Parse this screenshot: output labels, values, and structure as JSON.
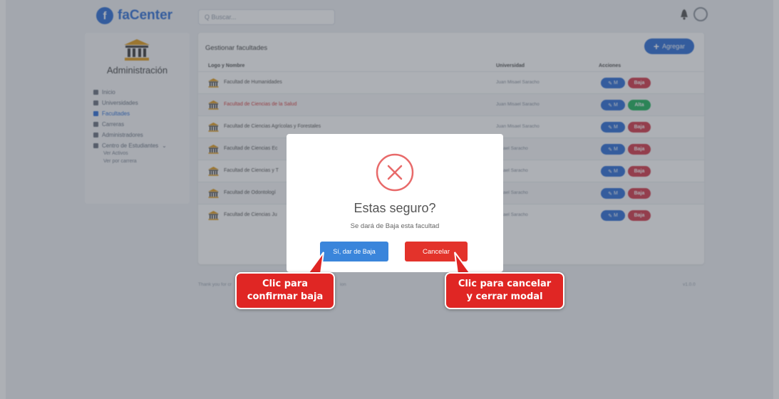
{
  "header": {
    "logo_mark": "f",
    "logo_text": "faCenter",
    "search_placeholder": "Q Buscar..."
  },
  "sidebar": {
    "title": "Administración",
    "items": [
      {
        "label": "Inicio",
        "icon": "home-icon"
      },
      {
        "label": "Universidades",
        "icon": "institution-icon"
      },
      {
        "label": "Facultades",
        "icon": "building-icon",
        "active": true
      },
      {
        "label": "Carreras",
        "icon": "book-icon"
      },
      {
        "label": "Administradores",
        "icon": "users-icon"
      },
      {
        "label": "Centro de Estudiantes",
        "icon": "gear-icon",
        "expandable": true
      }
    ],
    "subitems": [
      "Ver Activos",
      "Ver por carrera"
    ]
  },
  "card": {
    "title": "Gestionar facultades",
    "add_label": "Agregar",
    "columns": [
      "Logo y Nombre",
      "Universidad",
      "Acciones"
    ],
    "edit_label": "M",
    "rows": [
      {
        "name": "Facultad de Humanidades",
        "university": "Juan Misael Saracho",
        "state": "Baja",
        "state_color": "#d33b4c"
      },
      {
        "name": "Facultad de Ciencias de la Salud",
        "university": "Juan Misael Saracho",
        "state": "Alta",
        "state_color": "#22b35e",
        "highlight": true
      },
      {
        "name": "Facultad de Ciencias Agrícolas y Forestales",
        "university": "Juan Misael Saracho",
        "state": "Baja",
        "state_color": "#d33b4c"
      },
      {
        "name": "Facultad de Ciencias Ec",
        "university": "Misael Saracho",
        "state": "Baja",
        "state_color": "#d33b4c"
      },
      {
        "name": "Facultad de Ciencias y T",
        "university": "Misael Saracho",
        "state": "Baja",
        "state_color": "#d33b4c"
      },
      {
        "name": "Facultad de Odontologí",
        "university": "Misael Saracho",
        "state": "Baja",
        "state_color": "#d33b4c"
      },
      {
        "name": "Facultad de Ciencias Ju",
        "university": "Misael Saracho",
        "state": "Baja",
        "state_color": "#d33b4c"
      }
    ]
  },
  "footer": {
    "left": "Thank you for cr",
    "left_tail": "ion",
    "right": "v1.0.0"
  },
  "modal": {
    "title": "Estas seguro?",
    "text": "Se dará de Baja esta facultad",
    "confirm_label": "Sí, dar de Baja",
    "cancel_label": "Cancelar"
  },
  "callouts": {
    "left": [
      "Clic para",
      "confirmar baja"
    ],
    "right": [
      "Clic para cancelar",
      "y cerrar modal"
    ],
    "color": "#e02624"
  },
  "colors": {
    "accent": "#2f6fd6",
    "danger": "#e3332b",
    "confirm": "#3a85db"
  }
}
